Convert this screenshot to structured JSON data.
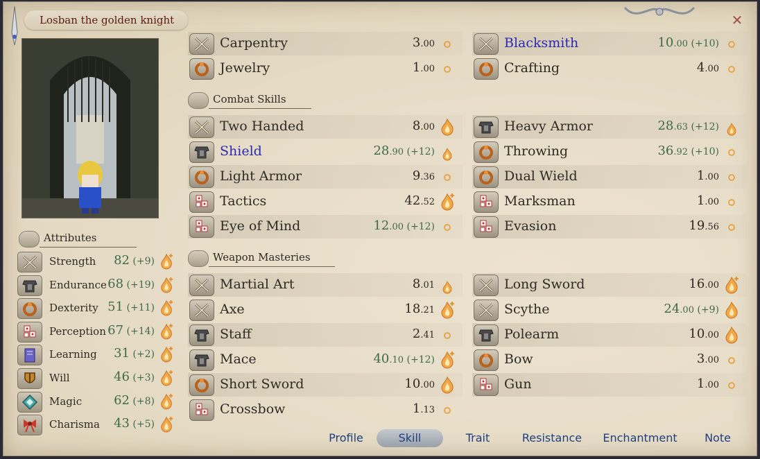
{
  "window": {
    "title": "Losban the golden knight",
    "close_label": "✕"
  },
  "attributes_header": "Attributes",
  "attributes": [
    {
      "icon": "crossed-swords-icon",
      "label": "Strength",
      "value": "82",
      "bonus": "(+9)",
      "mark": "flame-plus"
    },
    {
      "icon": "armor-icon",
      "label": "Endurance",
      "value": "68",
      "bonus": "(+19)",
      "mark": "flame-plus"
    },
    {
      "icon": "ring-icon",
      "label": "Dexterity",
      "value": "51",
      "bonus": "(+11)",
      "mark": "flame-plus"
    },
    {
      "icon": "dice-icon",
      "label": "Perception",
      "value": "67",
      "bonus": "(+14)",
      "mark": "flame-plus"
    },
    {
      "icon": "book-icon",
      "label": "Learning",
      "value": "31",
      "bonus": "(+2)",
      "mark": "flame-plus"
    },
    {
      "icon": "shield-icon",
      "label": "Will",
      "value": "46",
      "bonus": "(+3)",
      "mark": "flame-plus"
    },
    {
      "icon": "magic-rune-icon",
      "label": "Magic",
      "value": "62",
      "bonus": "(+8)",
      "mark": "flame-plus"
    },
    {
      "icon": "ribbon-icon",
      "label": "Charisma",
      "value": "43",
      "bonus": "(+5)",
      "mark": "flame-plus"
    }
  ],
  "crafting_skills": [
    {
      "icon": "crossed-swords-icon",
      "name": "Carpentry",
      "int": "3",
      "dec": ".00",
      "bonus": "",
      "name_color": "normal",
      "value_color": "normal",
      "mark": "dot"
    },
    {
      "icon": "crossed-swords-icon",
      "name": "Blacksmith",
      "int": "10",
      "dec": ".00",
      "bonus": "(+10)",
      "name_color": "blue",
      "value_color": "green",
      "mark": "dot"
    },
    {
      "icon": "ring-icon",
      "name": "Jewelry",
      "int": "1",
      "dec": ".00",
      "bonus": "",
      "name_color": "normal",
      "value_color": "normal",
      "mark": "dot"
    },
    {
      "icon": "ring-icon",
      "name": "Crafting",
      "int": "4",
      "dec": ".00",
      "bonus": "",
      "name_color": "normal",
      "value_color": "normal",
      "mark": "dot"
    }
  ],
  "combat_header": "Combat Skills",
  "combat_skills": [
    {
      "icon": "crossed-swords-icon",
      "name": "Two Handed",
      "int": "8",
      "dec": ".00",
      "bonus": "",
      "name_color": "normal",
      "value_color": "normal",
      "mark": "flame"
    },
    {
      "icon": "armor-icon",
      "name": "Heavy Armor",
      "int": "28",
      "dec": ".63",
      "bonus": "(+12)",
      "name_color": "normal",
      "value_color": "green",
      "mark": "flame-small"
    },
    {
      "icon": "armor-icon",
      "name": "Shield",
      "int": "28",
      "dec": ".90",
      "bonus": "(+12)",
      "name_color": "blue",
      "value_color": "green",
      "mark": "flame-small"
    },
    {
      "icon": "ring-icon",
      "name": "Throwing",
      "int": "36",
      "dec": ".92",
      "bonus": "(+10)",
      "name_color": "normal",
      "value_color": "green",
      "mark": "dot"
    },
    {
      "icon": "ring-icon",
      "name": "Light Armor",
      "int": "9",
      "dec": ".36",
      "bonus": "",
      "name_color": "normal",
      "value_color": "normal",
      "mark": "dot"
    },
    {
      "icon": "ring-icon",
      "name": "Dual Wield",
      "int": "1",
      "dec": ".00",
      "bonus": "",
      "name_color": "normal",
      "value_color": "normal",
      "mark": "dot"
    },
    {
      "icon": "dice-icon",
      "name": "Tactics",
      "int": "42",
      "dec": ".52",
      "bonus": "",
      "name_color": "normal",
      "value_color": "normal",
      "mark": "flame-plus"
    },
    {
      "icon": "dice-icon",
      "name": "Marksman",
      "int": "1",
      "dec": ".00",
      "bonus": "",
      "name_color": "normal",
      "value_color": "normal",
      "mark": "dot"
    },
    {
      "icon": "dice-icon",
      "name": "Eye of Mind",
      "int": "12",
      "dec": ".00",
      "bonus": "(+12)",
      "name_color": "normal",
      "value_color": "green",
      "mark": "dot"
    },
    {
      "icon": "dice-icon",
      "name": "Evasion",
      "int": "19",
      "dec": ".56",
      "bonus": "",
      "name_color": "normal",
      "value_color": "normal",
      "mark": "dot"
    }
  ],
  "weapon_header": "Weapon Masteries",
  "weapon_skills": [
    {
      "icon": "crossed-swords-icon",
      "name": "Martial Art",
      "int": "8",
      "dec": ".01",
      "bonus": "",
      "name_color": "normal",
      "value_color": "normal",
      "mark": "flame-small"
    },
    {
      "icon": "crossed-swords-icon",
      "name": "Long Sword",
      "int": "16",
      "dec": ".00",
      "bonus": "",
      "name_color": "normal",
      "value_color": "normal",
      "mark": "flame-plus"
    },
    {
      "icon": "crossed-swords-icon",
      "name": "Axe",
      "int": "18",
      "dec": ".21",
      "bonus": "",
      "name_color": "normal",
      "value_color": "normal",
      "mark": "flame-plus"
    },
    {
      "icon": "crossed-swords-icon",
      "name": "Scythe",
      "int": "24",
      "dec": ".00",
      "bonus": "(+9)",
      "name_color": "normal",
      "value_color": "green",
      "mark": "flame"
    },
    {
      "icon": "armor-icon",
      "name": "Staff",
      "int": "2",
      "dec": ".41",
      "bonus": "",
      "name_color": "normal",
      "value_color": "normal",
      "mark": "dot"
    },
    {
      "icon": "armor-icon",
      "name": "Polearm",
      "int": "10",
      "dec": ".00",
      "bonus": "",
      "name_color": "normal",
      "value_color": "normal",
      "mark": "flame"
    },
    {
      "icon": "armor-icon",
      "name": "Mace",
      "int": "40",
      "dec": ".10",
      "bonus": "(+12)",
      "name_color": "normal",
      "value_color": "green",
      "mark": "flame-plus"
    },
    {
      "icon": "ring-icon",
      "name": "Bow",
      "int": "3",
      "dec": ".00",
      "bonus": "",
      "name_color": "normal",
      "value_color": "normal",
      "mark": "dot"
    },
    {
      "icon": "ring-icon",
      "name": "Short Sword",
      "int": "10",
      "dec": ".00",
      "bonus": "",
      "name_color": "normal",
      "value_color": "normal",
      "mark": "flame"
    },
    {
      "icon": "dice-icon",
      "name": "Gun",
      "int": "1",
      "dec": ".00",
      "bonus": "",
      "name_color": "normal",
      "value_color": "normal",
      "mark": "dot"
    },
    {
      "icon": "dice-icon",
      "name": "Crossbow",
      "int": "1",
      "dec": ".13",
      "bonus": "",
      "name_color": "normal",
      "value_color": "normal",
      "mark": "dot"
    }
  ],
  "tabs": [
    {
      "label": "Profile",
      "active": false
    },
    {
      "label": "Skill",
      "active": true
    },
    {
      "label": "Trait",
      "active": false
    },
    {
      "label": "Resistance",
      "active": false
    },
    {
      "label": "Enchantment",
      "active": false
    },
    {
      "label": "Note",
      "active": false
    }
  ],
  "colors": {
    "green_value": "#3e6b45",
    "blue_name": "#2a2ab0",
    "tab_text": "#1f3f80",
    "title_text": "#5a1a10"
  }
}
